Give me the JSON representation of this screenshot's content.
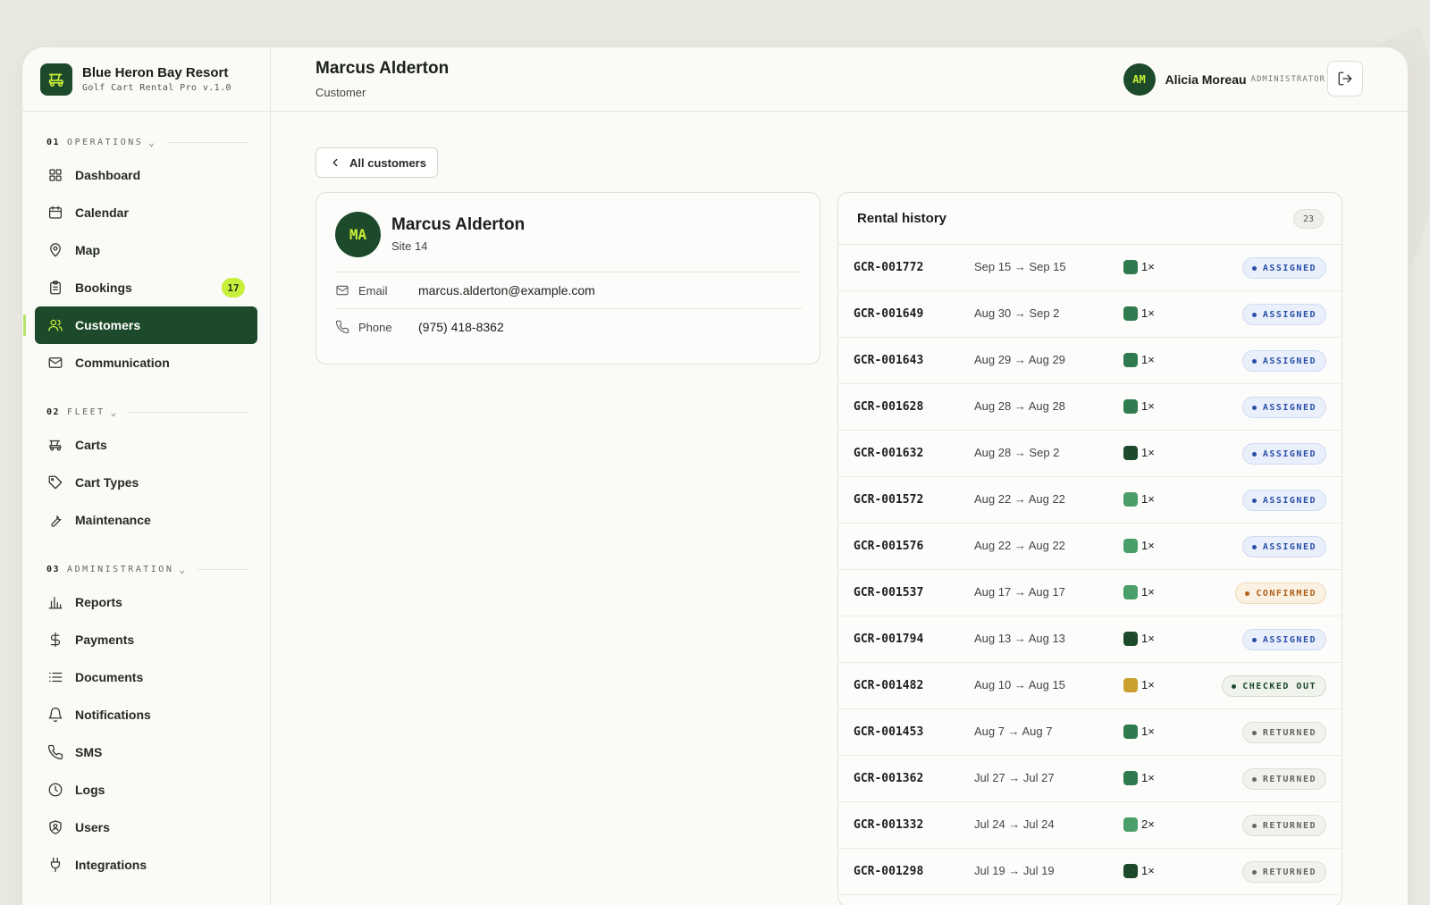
{
  "brand": {
    "name": "Blue Heron Bay Resort",
    "subtitle": "Golf Cart Rental Pro v.1.0"
  },
  "nav": {
    "sections": [
      {
        "num": "01",
        "title": "OPERATIONS",
        "items": [
          {
            "label": "Dashboard",
            "icon": "grid-icon"
          },
          {
            "label": "Calendar",
            "icon": "calendar-icon"
          },
          {
            "label": "Map",
            "icon": "map-pin-icon"
          },
          {
            "label": "Bookings",
            "icon": "clipboard-icon",
            "badge": "17"
          },
          {
            "label": "Customers",
            "icon": "users-icon",
            "active": true
          },
          {
            "label": "Communication",
            "icon": "mail-icon"
          }
        ]
      },
      {
        "num": "02",
        "title": "FLEET",
        "items": [
          {
            "label": "Carts",
            "icon": "golf-cart-icon"
          },
          {
            "label": "Cart Types",
            "icon": "tag-icon"
          },
          {
            "label": "Maintenance",
            "icon": "wrench-icon"
          }
        ]
      },
      {
        "num": "03",
        "title": "ADMINISTRATION",
        "items": [
          {
            "label": "Reports",
            "icon": "bar-chart-icon"
          },
          {
            "label": "Payments",
            "icon": "dollar-icon"
          },
          {
            "label": "Documents",
            "icon": "list-icon"
          },
          {
            "label": "Notifications",
            "icon": "bell-icon"
          },
          {
            "label": "SMS",
            "icon": "phone-icon"
          },
          {
            "label": "Logs",
            "icon": "clock-icon"
          },
          {
            "label": "Users",
            "icon": "shield-user-icon"
          },
          {
            "label": "Integrations",
            "icon": "plug-icon"
          }
        ]
      }
    ]
  },
  "header": {
    "title": "Marcus Alderton",
    "subtitle": "Customer"
  },
  "user": {
    "initials": "AM",
    "name": "Alicia Moreau",
    "role": "ADMINISTRATOR"
  },
  "back_label": "All customers",
  "customer": {
    "initials": "MA",
    "name": "Marcus Alderton",
    "site": "Site 14",
    "email_label": "Email",
    "email": "marcus.alderton@example.com",
    "phone_label": "Phone",
    "phone": "(975) 418-8362"
  },
  "history": {
    "title": "Rental history",
    "count": "23",
    "rows": [
      {
        "id": "GCR-001772",
        "dates": "Sep 15 → Sep 15",
        "color": "#2f7a4f",
        "qty": "1×",
        "status": "ASSIGNED"
      },
      {
        "id": "GCR-001649",
        "dates": "Aug 30 → Sep 2",
        "color": "#2f7a4f",
        "qty": "1×",
        "status": "ASSIGNED"
      },
      {
        "id": "GCR-001643",
        "dates": "Aug 29 → Aug 29",
        "color": "#2f7a4f",
        "qty": "1×",
        "status": "ASSIGNED"
      },
      {
        "id": "GCR-001628",
        "dates": "Aug 28 → Aug 28",
        "color": "#2f7a4f",
        "qty": "1×",
        "status": "ASSIGNED"
      },
      {
        "id": "GCR-001632",
        "dates": "Aug 28 → Sep 2",
        "color": "#1d4a2a",
        "qty": "1×",
        "status": "ASSIGNED"
      },
      {
        "id": "GCR-001572",
        "dates": "Aug 22 → Aug 22",
        "color": "#4a9e6a",
        "qty": "1×",
        "status": "ASSIGNED"
      },
      {
        "id": "GCR-001576",
        "dates": "Aug 22 → Aug 22",
        "color": "#4a9e6a",
        "qty": "1×",
        "status": "ASSIGNED"
      },
      {
        "id": "GCR-001537",
        "dates": "Aug 17 → Aug 17",
        "color": "#4a9e6a",
        "qty": "1×",
        "status": "CONFIRMED"
      },
      {
        "id": "GCR-001794",
        "dates": "Aug 13 → Aug 13",
        "color": "#1d4a2a",
        "qty": "1×",
        "status": "ASSIGNED"
      },
      {
        "id": "GCR-001482",
        "dates": "Aug 10 → Aug 15",
        "color": "#c9a030",
        "qty": "1×",
        "status": "CHECKED OUT"
      },
      {
        "id": "GCR-001453",
        "dates": "Aug 7 → Aug 7",
        "color": "#2f7a4f",
        "qty": "1×",
        "status": "RETURNED"
      },
      {
        "id": "GCR-001362",
        "dates": "Jul 27 → Jul 27",
        "color": "#2f7a4f",
        "qty": "1×",
        "status": "RETURNED"
      },
      {
        "id": "GCR-001332",
        "dates": "Jul 24 → Jul 24",
        "color": "#4a9e6a",
        "qty": "2×",
        "status": "RETURNED"
      },
      {
        "id": "GCR-001298",
        "dates": "Jul 19 → Jul 19",
        "color": "#1d4a2a",
        "qty": "1×",
        "status": "RETURNED"
      }
    ]
  },
  "colors": {
    "brand": "#1d4a2a",
    "accent": "#c8ef3a",
    "ASSIGNED": {
      "fg": "#2b4fa8",
      "bg": "#eaf0fb",
      "border": "#cfdaf2"
    },
    "CONFIRMED": {
      "fg": "#b0601a",
      "bg": "#fbf1e3",
      "border": "#f0d8b8"
    },
    "CHECKED OUT": {
      "fg": "#1d4a2a",
      "bg": "#f0f2ec",
      "border": "#d5dccd"
    },
    "RETURNED": {
      "fg": "#666666",
      "bg": "#f1f1ee",
      "border": "#dddcd5"
    }
  }
}
